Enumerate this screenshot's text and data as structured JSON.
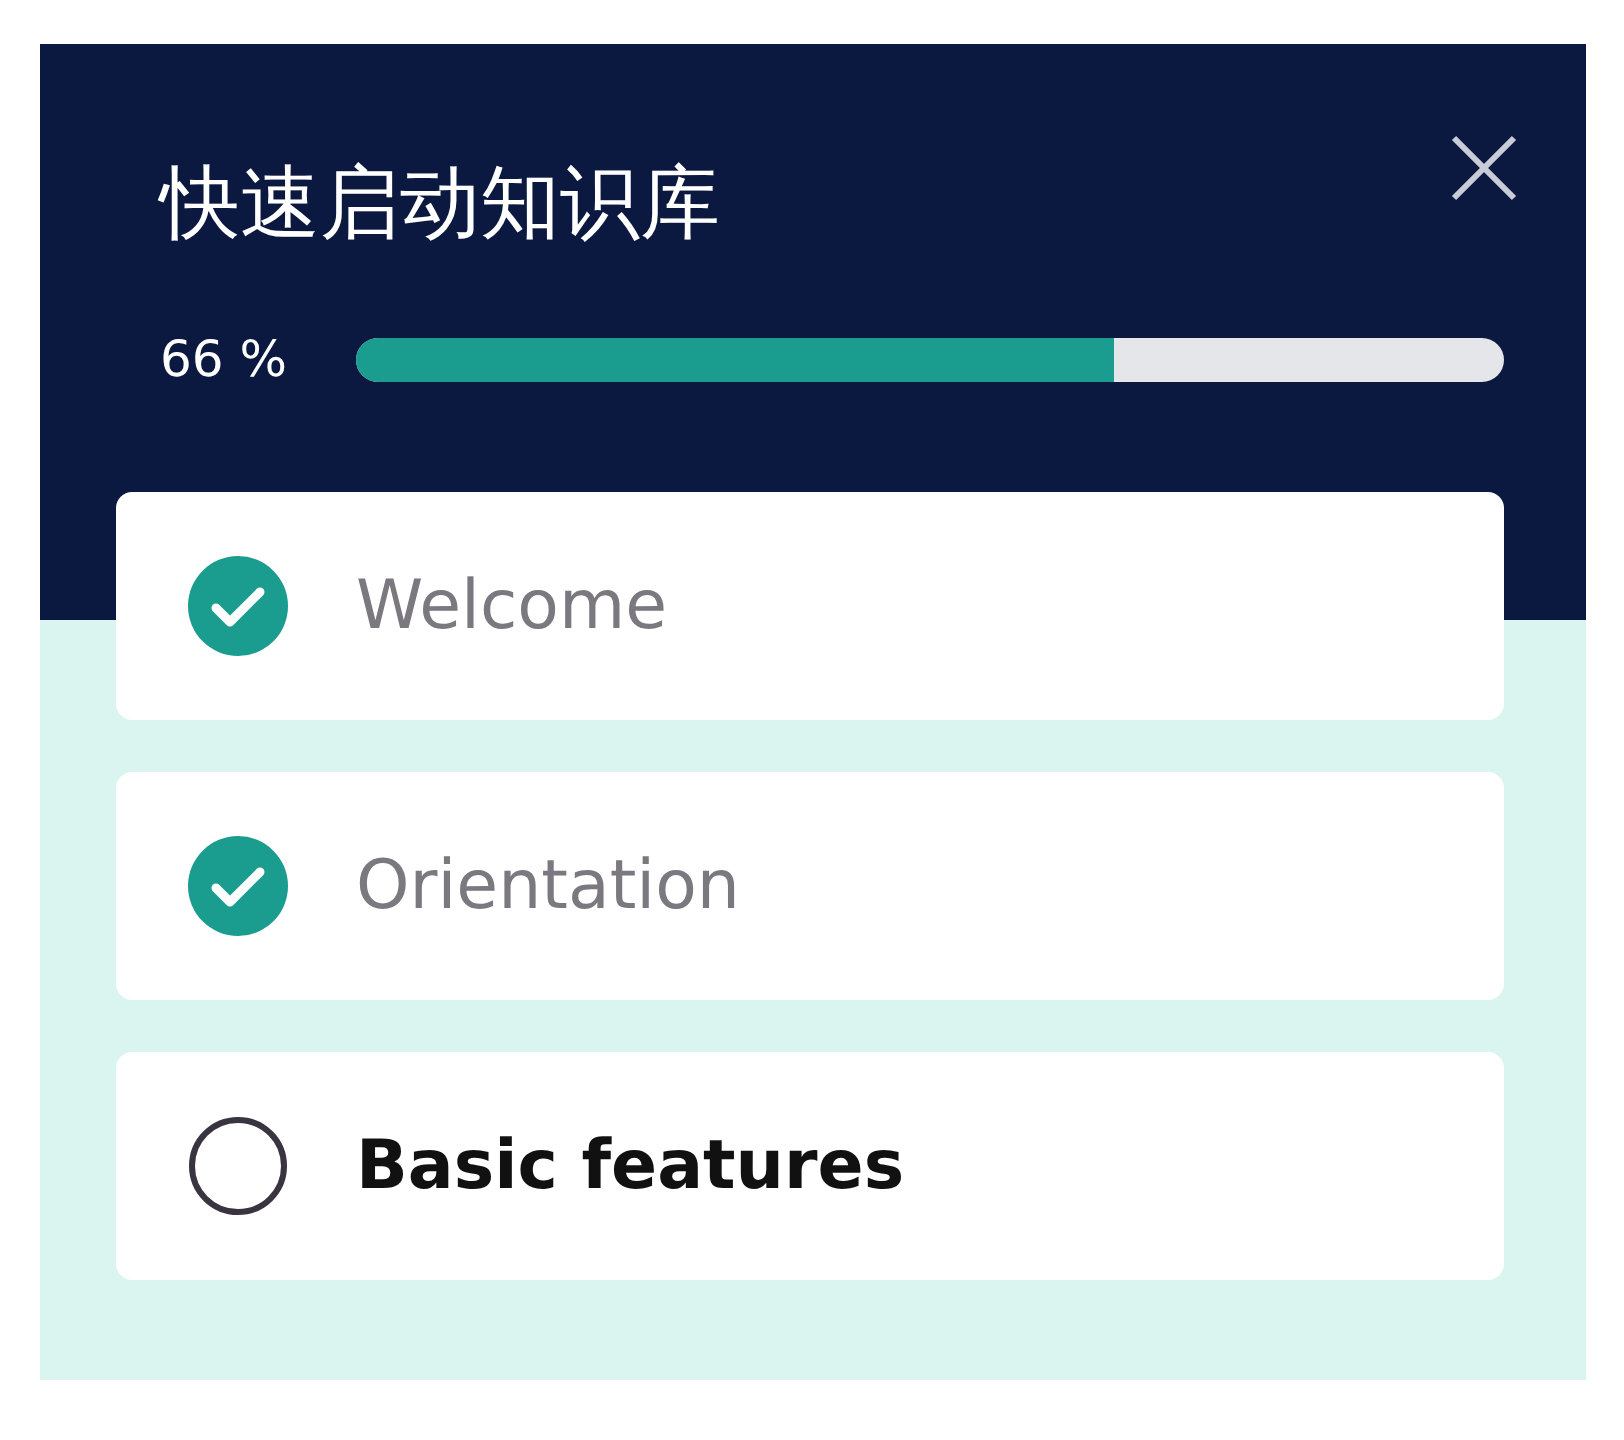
{
  "title": "快速启动知识库",
  "progress": {
    "reading": "66 %",
    "level": 0.66
  },
  "steps": [
    {
      "label": "Welcome",
      "checked": true
    },
    {
      "label": "Orientation",
      "checked": true
    },
    {
      "label": "Basic features",
      "checked": false
    }
  ]
}
